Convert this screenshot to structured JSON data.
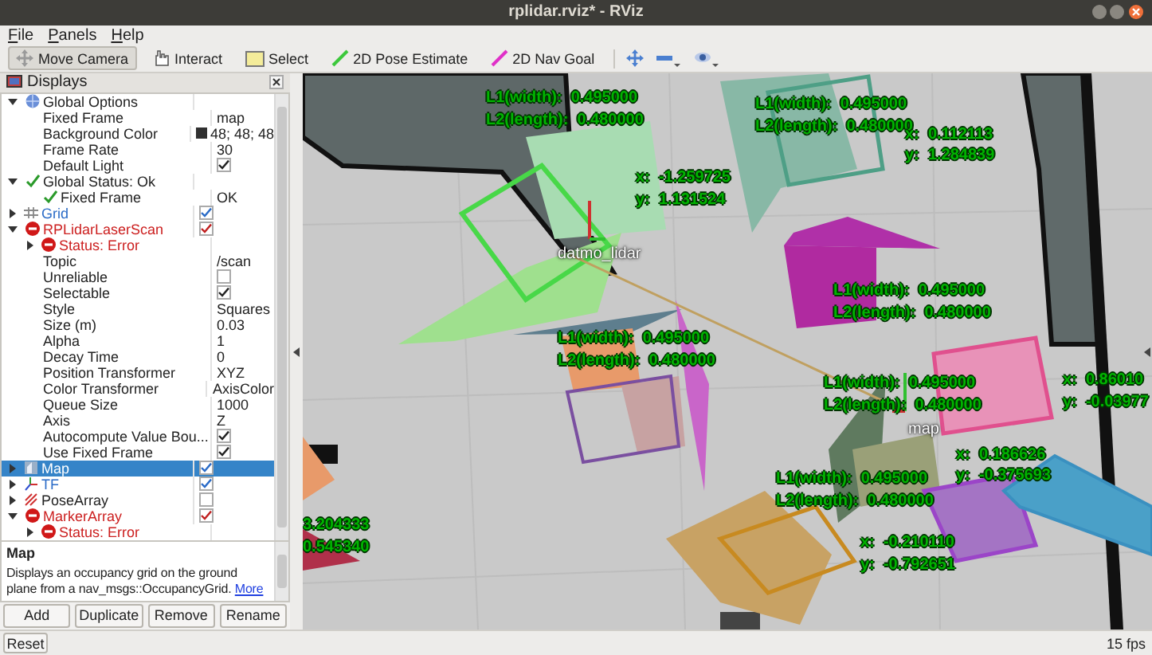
{
  "window": {
    "title": "rplidar.rviz* - RViz"
  },
  "menu": [
    "File",
    "Panels",
    "Help"
  ],
  "tools": [
    {
      "label": "Move Camera",
      "kind": "move",
      "selected": true
    },
    {
      "label": "Interact",
      "kind": "interact",
      "selected": false
    },
    {
      "label": "Select",
      "kind": "select",
      "selected": false
    },
    {
      "label": "2D Pose Estimate",
      "kind": "pose",
      "selected": false
    },
    {
      "label": "2D Nav Goal",
      "kind": "goal",
      "selected": false
    }
  ],
  "displays": {
    "title": "Displays",
    "items": [
      {
        "label": "Global Options",
        "kind": "options",
        "expanded": true,
        "selected": false,
        "children": [
          {
            "label": "Fixed Frame",
            "kind": "property",
            "value": "map",
            "selected": false
          },
          {
            "label": "Background Color",
            "kind": "property",
            "value": "48; 48; 48",
            "color": "#303030",
            "selected": false
          },
          {
            "label": "Frame Rate",
            "kind": "property",
            "value": "30",
            "selected": false
          },
          {
            "label": "Default Light",
            "kind": "property",
            "checked": true,
            "selected": false
          }
        ]
      },
      {
        "label": "Global Status: Ok",
        "kind": "status-ok",
        "expanded": true,
        "selected": false,
        "children": [
          {
            "label": "Fixed Frame",
            "kind": "status-ok",
            "value": "OK",
            "selected": false
          }
        ]
      },
      {
        "label": "Grid",
        "kind": "grid",
        "error": false,
        "expanded": false,
        "checked": true,
        "selected": false
      },
      {
        "label": "RPLidarLaserScan",
        "kind": "laserscan",
        "error": true,
        "expanded": true,
        "checked": true,
        "selected": false,
        "children": [
          {
            "label": "Status: Error",
            "kind": "status-error",
            "expanded": false,
            "selected": false
          },
          {
            "label": "Topic",
            "kind": "property",
            "value": "/scan",
            "selected": false
          },
          {
            "label": "Unreliable",
            "kind": "property",
            "checked": false,
            "selected": false
          },
          {
            "label": "Selectable",
            "kind": "property",
            "checked": true,
            "selected": false
          },
          {
            "label": "Style",
            "kind": "property",
            "value": "Squares",
            "selected": false
          },
          {
            "label": "Size (m)",
            "kind": "property",
            "value": "0.03",
            "selected": false
          },
          {
            "label": "Alpha",
            "kind": "property",
            "value": "1",
            "selected": false
          },
          {
            "label": "Decay Time",
            "kind": "property",
            "value": "0",
            "selected": false
          },
          {
            "label": "Position Transformer",
            "kind": "property",
            "value": "XYZ",
            "selected": false
          },
          {
            "label": "Color Transformer",
            "kind": "property",
            "value": "AxisColor",
            "selected": false
          },
          {
            "label": "Queue Size",
            "kind": "property",
            "value": "1000",
            "selected": false
          },
          {
            "label": "Axis",
            "kind": "property",
            "value": "Z",
            "selected": false
          },
          {
            "label": "Autocompute Value Bou...",
            "kind": "property",
            "checked": true,
            "selected": false
          },
          {
            "label": "Use Fixed Frame",
            "kind": "property",
            "checked": true,
            "selected": false
          }
        ]
      },
      {
        "label": "Map",
        "kind": "map",
        "error": false,
        "expanded": false,
        "checked": true,
        "selected": true
      },
      {
        "label": "TF",
        "kind": "tf",
        "error": false,
        "expanded": false,
        "checked": true,
        "selected": false
      },
      {
        "label": "PoseArray",
        "kind": "posearray",
        "error": false,
        "expanded": false,
        "checked": false,
        "selected": false
      },
      {
        "label": "MarkerArray",
        "kind": "markerarray",
        "error": true,
        "expanded": true,
        "checked": true,
        "selected": false,
        "children": [
          {
            "label": "Status: Error",
            "kind": "status-error",
            "expanded": false,
            "selected": false
          }
        ]
      }
    ]
  },
  "description": {
    "title": "Map",
    "text": "Displays an occupancy grid on the ground plane from a nav_msgs::OccupancyGrid.",
    "link": "More"
  },
  "buttons": [
    "Add",
    "Duplicate",
    "Remove",
    "Rename"
  ],
  "viewport": {
    "labels": [
      {
        "text": "L1(width):  0.495000",
        "kind": "marker"
      },
      {
        "text": "L2(length):  0.480000",
        "kind": "marker"
      },
      {
        "text": "L1(width):  0.495000",
        "kind": "marker"
      },
      {
        "text": "L2(length):  0.480000",
        "kind": "marker"
      },
      {
        "text": "x:  0.112113",
        "kind": "marker"
      },
      {
        "text": "y:  1.284839",
        "kind": "marker"
      },
      {
        "text": "x:  -1.259725",
        "kind": "marker"
      },
      {
        "text": "y:  1.131524",
        "kind": "marker"
      },
      {
        "text": "datmo_lidar",
        "kind": "frame"
      },
      {
        "text": "L1(width):  0.495000",
        "kind": "marker"
      },
      {
        "text": "L2(length):  0.480000",
        "kind": "marker"
      },
      {
        "text": "L1(width):  0.495000",
        "kind": "marker"
      },
      {
        "text": "L2(length):  0.480000",
        "kind": "marker"
      },
      {
        "text": "L1(width):  0.495000",
        "kind": "marker"
      },
      {
        "text": "L2(length):  0.480000",
        "kind": "marker"
      },
      {
        "text": "map",
        "kind": "frame"
      },
      {
        "text": "x:  0.86010",
        "kind": "marker"
      },
      {
        "text": "y:  -0.03977",
        "kind": "marker"
      },
      {
        "text": "x:  0.186626",
        "kind": "marker"
      },
      {
        "text": "y:  -0.375693",
        "kind": "marker"
      },
      {
        "text": "L1(width):  0.495000",
        "kind": "marker"
      },
      {
        "text": "L2(length):  0.480000",
        "kind": "marker"
      },
      {
        "text": "x:  -0.210110",
        "kind": "marker"
      },
      {
        "text": "y:  -0.792651",
        "kind": "marker"
      },
      {
        "text": "3.204333",
        "kind": "marker"
      },
      {
        "text": "0.545340",
        "kind": "marker"
      }
    ]
  },
  "reset": "Reset",
  "fps": "15 fps"
}
